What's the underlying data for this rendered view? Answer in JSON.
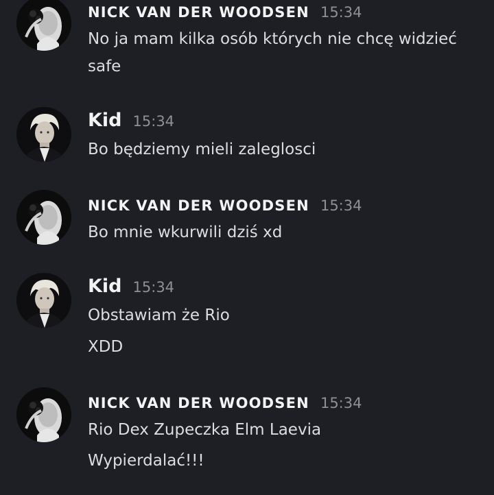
{
  "messages": [
    {
      "author": "NICK VAN DER WOODSEN",
      "time": "15:34",
      "lines": [
        "No ja mam kilka osób których nie chcę widzieć",
        "safe"
      ]
    },
    {
      "author": "Kid",
      "time": "15:34",
      "lines": [
        "Bo będziemy mieli zaleglosci"
      ]
    },
    {
      "author": "NICK VAN DER WOODSEN",
      "time": "15:34",
      "lines": [
        "Bo mnie wkurwili dziś xd"
      ]
    },
    {
      "author": "Kid",
      "time": "15:34",
      "lines": [
        "Obstawiam że Rio",
        "XDD"
      ]
    },
    {
      "author": "NICK VAN DER WOODSEN",
      "time": "15:34",
      "lines": [
        "Rio Dex Zupeczka Elm Laevia",
        "Wypierdalać!!!"
      ]
    }
  ],
  "colors": {
    "background": "#1e1f24",
    "author": "#f2f3f5",
    "timestamp": "#8e9097",
    "text": "#dcdde1"
  },
  "icons": {
    "nick_avatar": "avatar-rose-mask-icon",
    "kid_avatar": "avatar-blonde-portrait-icon"
  }
}
